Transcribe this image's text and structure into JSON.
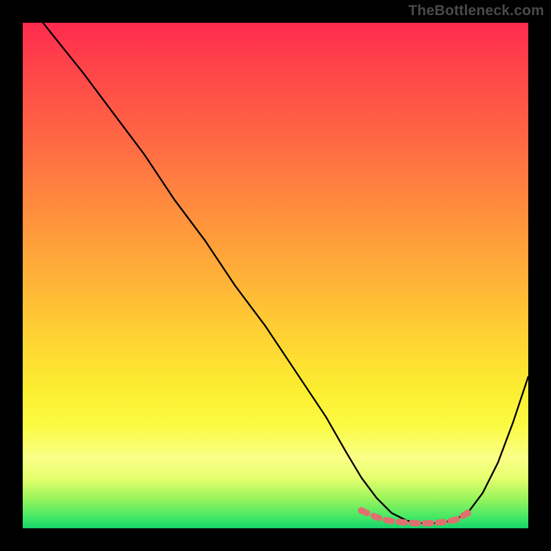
{
  "watermark": "TheBottleneck.com",
  "chart_data": {
    "type": "line",
    "title": "",
    "xlabel": "",
    "ylabel": "",
    "xlim": [
      0,
      100
    ],
    "ylim": [
      0,
      100
    ],
    "grid": false,
    "legend": false,
    "series": [
      {
        "name": "curve",
        "color": "#000000",
        "x": [
          4,
          8,
          12,
          18,
          24,
          30,
          36,
          42,
          48,
          54,
          60,
          64,
          67,
          70,
          73,
          76,
          79,
          82,
          85,
          88,
          91,
          94,
          97,
          100
        ],
        "y": [
          100,
          95,
          90,
          82,
          74,
          65,
          57,
          48,
          40,
          31,
          22,
          15,
          10,
          6,
          3,
          1.5,
          1,
          1,
          1.5,
          3,
          7,
          13,
          21,
          30
        ]
      },
      {
        "name": "highlight",
        "color": "#e07070",
        "style": "thick-dotted",
        "x": [
          67,
          70,
          72,
          74,
          76,
          78,
          80,
          82,
          84,
          86,
          88
        ],
        "y": [
          3.5,
          2.2,
          1.6,
          1.3,
          1.1,
          1.0,
          1.0,
          1.1,
          1.3,
          1.8,
          3.0
        ]
      }
    ],
    "background_gradient": {
      "top": "#ff2b4e",
      "mid": "#ffd233",
      "bottom": "#17d36b"
    }
  }
}
